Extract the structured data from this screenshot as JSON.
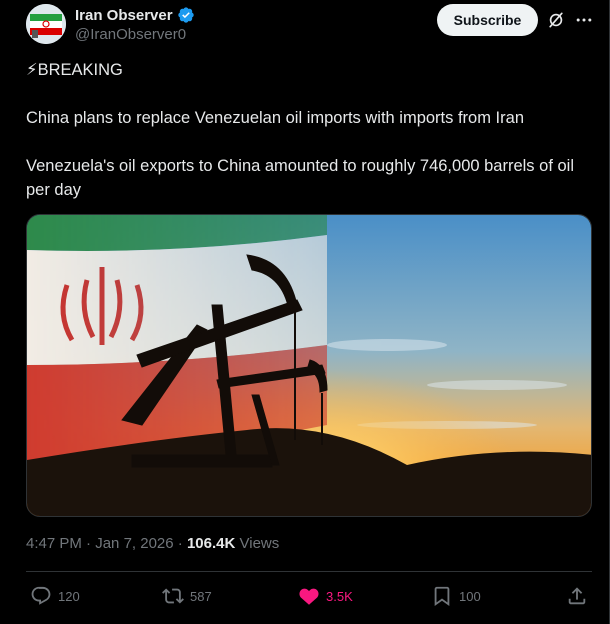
{
  "author": {
    "name": "Iran Observer",
    "handle": "@IranObserver0",
    "verified": true,
    "accent": "#1d9bf0"
  },
  "header": {
    "subscribe_label": "Subscribe",
    "grok_icon": "grok-icon",
    "more_icon": "more-icon"
  },
  "post": {
    "line1": "⚡BREAKING",
    "line2": "China plans to replace Venezuelan oil imports with imports from Iran",
    "line3": "Venezuela's oil exports to China amounted to roughly 746,000 barrels of oil per day"
  },
  "meta": {
    "time": "4:47 PM",
    "dot": " · ",
    "date": "Jan 7, 2026",
    "views_count": "106.4K",
    "views_label": "Views"
  },
  "actions": {
    "replies": "120",
    "reposts": "587",
    "likes": "3.5K",
    "bookmarks": "100",
    "like_color": "#f91880"
  }
}
